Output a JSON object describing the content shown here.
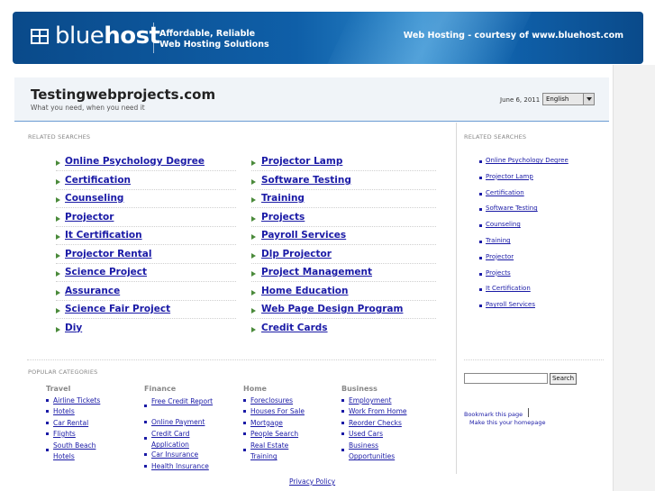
{
  "banner": {
    "logo_light": "blue",
    "logo_bold": "host",
    "tagline_line1": "Affordable, Reliable",
    "tagline_line2": "Web Hosting Solutions",
    "courtesy": "Web Hosting - courtesy of www.bluehost.com"
  },
  "header": {
    "title": "Testingwebprojects.com",
    "tagline": "What you need, when you need it",
    "date": "June 6, 2011",
    "language": "English"
  },
  "main": {
    "section_label": "RELATED SEARCHES",
    "left_links": [
      "Online Psychology Degree",
      "Certification",
      "Counseling",
      "Projector",
      "It Certification",
      "Projector Rental",
      "Science Project",
      "Assurance",
      "Science Fair Project",
      "Diy"
    ],
    "right_links": [
      "Projector Lamp",
      "Software Testing",
      "Training",
      "Projects",
      "Payroll Services",
      "Dlp Projector",
      "Project Management",
      "Home Education",
      "Web Page Design Program",
      "Credit Cards"
    ]
  },
  "sidebar": {
    "section_label": "RELATED SEARCHES",
    "links": [
      "Online Psychology Degree",
      "Projector Lamp",
      "Certification",
      "Software Testing",
      "Counseling",
      "Training",
      "Projector",
      "Projects",
      "It Certification",
      "Payroll Services"
    ],
    "search_button": "Search",
    "bookmark": "Bookmark this page",
    "homepage": "Make this your homepage"
  },
  "popular": {
    "section_label": "POPULAR CATEGORIES",
    "columns": [
      {
        "heading": "Travel",
        "items": [
          "Airline Tickets",
          "Hotels",
          "Car Rental",
          "Flights",
          "South Beach Hotels"
        ]
      },
      {
        "heading": "Finance",
        "items": [
          "Free Credit Report",
          "Online Payment",
          "Credit Card Application",
          "Car Insurance",
          "Health Insurance"
        ]
      },
      {
        "heading": "Home",
        "items": [
          "Foreclosures",
          "Houses For Sale",
          "Mortgage",
          "People Search",
          "Real Estate Training"
        ]
      },
      {
        "heading": "Business",
        "items": [
          "Employment",
          "Work From Home",
          "Reorder Checks",
          "Used Cars",
          "Business Opportunities"
        ]
      }
    ]
  },
  "footer": {
    "privacy": "Privacy Policy"
  }
}
